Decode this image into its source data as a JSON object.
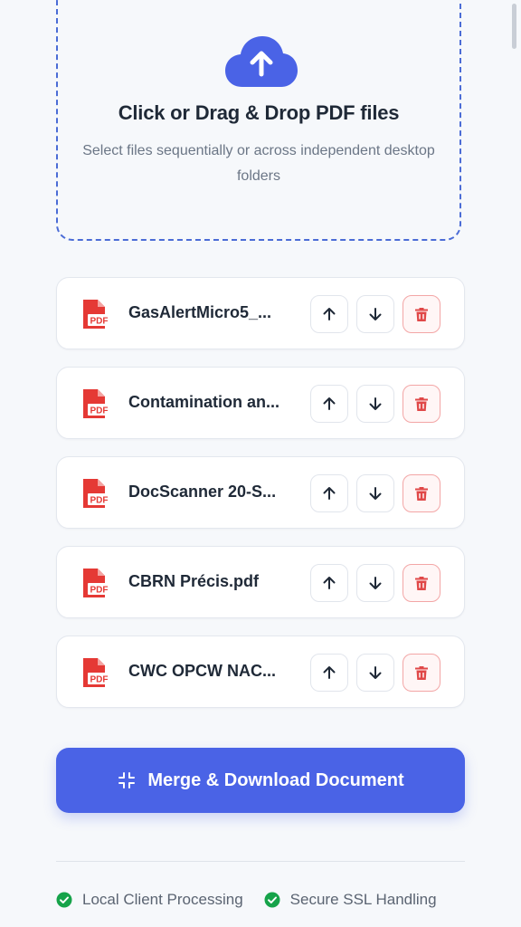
{
  "dropzone": {
    "icon": "cloud-upload-icon",
    "title": "Click or Drag & Drop PDF files",
    "subtitle": "Select files sequentially or across independent desktop folders"
  },
  "files": [
    {
      "name": "GasAlertMicro5_...",
      "icon": "pdf-file-icon"
    },
    {
      "name": "Contamination an...",
      "icon": "pdf-file-icon"
    },
    {
      "name": "DocScanner 20-S...",
      "icon": "pdf-file-icon"
    },
    {
      "name": "CBRN Précis.pdf",
      "icon": "pdf-file-icon"
    },
    {
      "name": "CWC OPCW NAC...",
      "icon": "pdf-file-icon"
    }
  ],
  "file_actions": {
    "move_up_icon": "arrow-up-icon",
    "move_down_icon": "arrow-down-icon",
    "delete_icon": "trash-icon"
  },
  "merge_button": {
    "label": "Merge & Download Document",
    "icon": "merge-arrows-icon"
  },
  "footer": {
    "badges": [
      {
        "label": "Local Client Processing",
        "icon": "check-circle-icon"
      },
      {
        "label": "Secure SSL Handling",
        "icon": "check-circle-icon"
      }
    ]
  },
  "colors": {
    "accent": "#4a63e6",
    "dropzone_border": "#4b6cd6",
    "pdf_red": "#e53935",
    "delete_red": "#e04848",
    "success_green": "#16a34a",
    "background": "#f6f8fb"
  }
}
